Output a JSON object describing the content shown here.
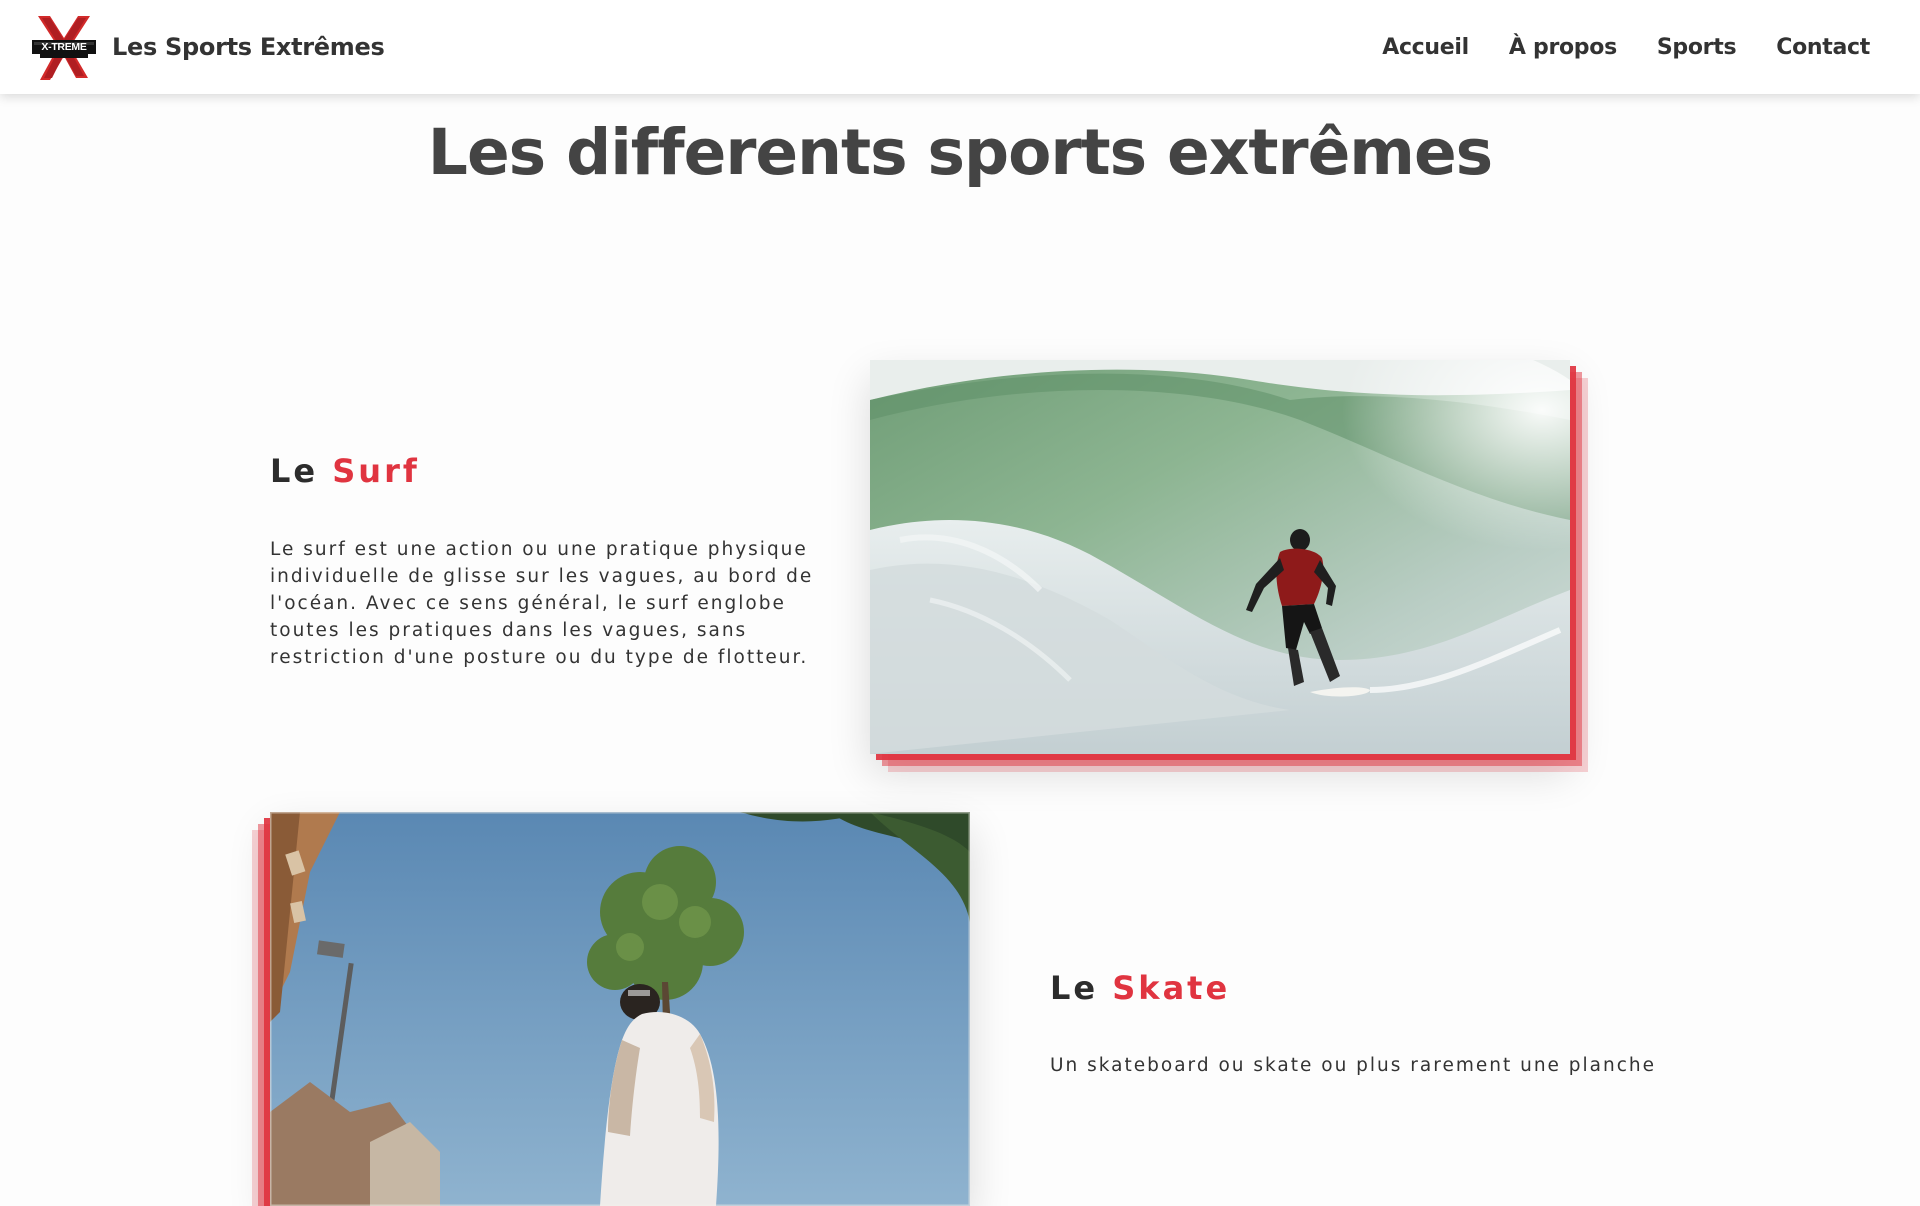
{
  "header": {
    "logo_text": "X-TREME",
    "brand_name": "Les Sports Extrêmes",
    "nav": [
      {
        "label": "Accueil"
      },
      {
        "label": "À propos"
      },
      {
        "label": "Sports"
      },
      {
        "label": "Contact"
      }
    ]
  },
  "main": {
    "title": "Les differents sports extrêmes",
    "sports": [
      {
        "prefix": "Le",
        "name": "Surf",
        "description": "Le surf est une action ou une pratique physique individuelle de glisse sur les vagues, au bord de l'océan. Avec ce sens général, le surf englobe toutes les pratiques dans les vagues, sans restriction d'une posture ou du type de flotteur."
      },
      {
        "prefix": "Le",
        "name": "Skate",
        "description": "Un skateboard ou skate ou plus rarement une planche"
      }
    ]
  },
  "colors": {
    "accent": "#e03440",
    "text_dark": "#333333",
    "title": "#444444"
  }
}
